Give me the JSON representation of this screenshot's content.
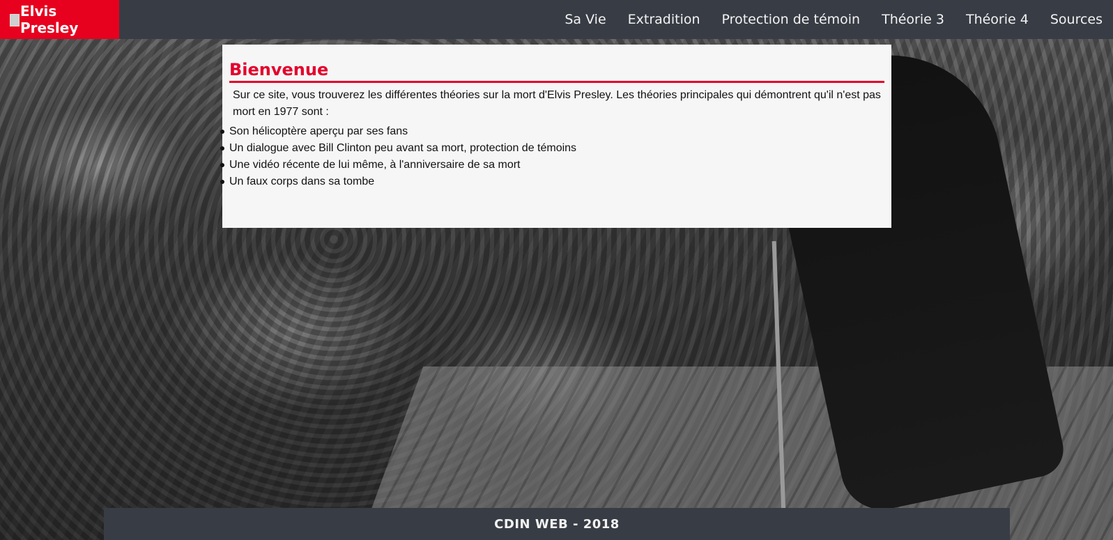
{
  "brand": {
    "name": "Elvis Presley",
    "logo_icon": "broken-image-icon",
    "color": "#e8001f"
  },
  "nav": {
    "items": [
      {
        "label": "Sa Vie"
      },
      {
        "label": "Extradition"
      },
      {
        "label": "Protection de témoin"
      },
      {
        "label": "Théorie 3"
      },
      {
        "label": "Théorie 4"
      },
      {
        "label": "Sources"
      }
    ]
  },
  "main": {
    "title": "Bienvenue",
    "intro": "Sur ce site, vous trouverez les différentes théories sur la mort d'Elvis Presley. Les théories principales qui démontrent qu'il n'est pas mort en 1977 sont :",
    "theories": [
      "Son hélicoptère aperçu par ses fans",
      "Un dialogue avec Bill Clinton peu avant sa mort, protection de témoins",
      "Une vidéo récente de lui même, à l'anniversaire de sa mort",
      "Un faux corps dans sa tombe"
    ]
  },
  "footer": {
    "text": "CDIN WEB - 2018"
  },
  "colors": {
    "accent": "#e4002b",
    "navbar": "#383c45",
    "panel": "#f6f6f6"
  }
}
